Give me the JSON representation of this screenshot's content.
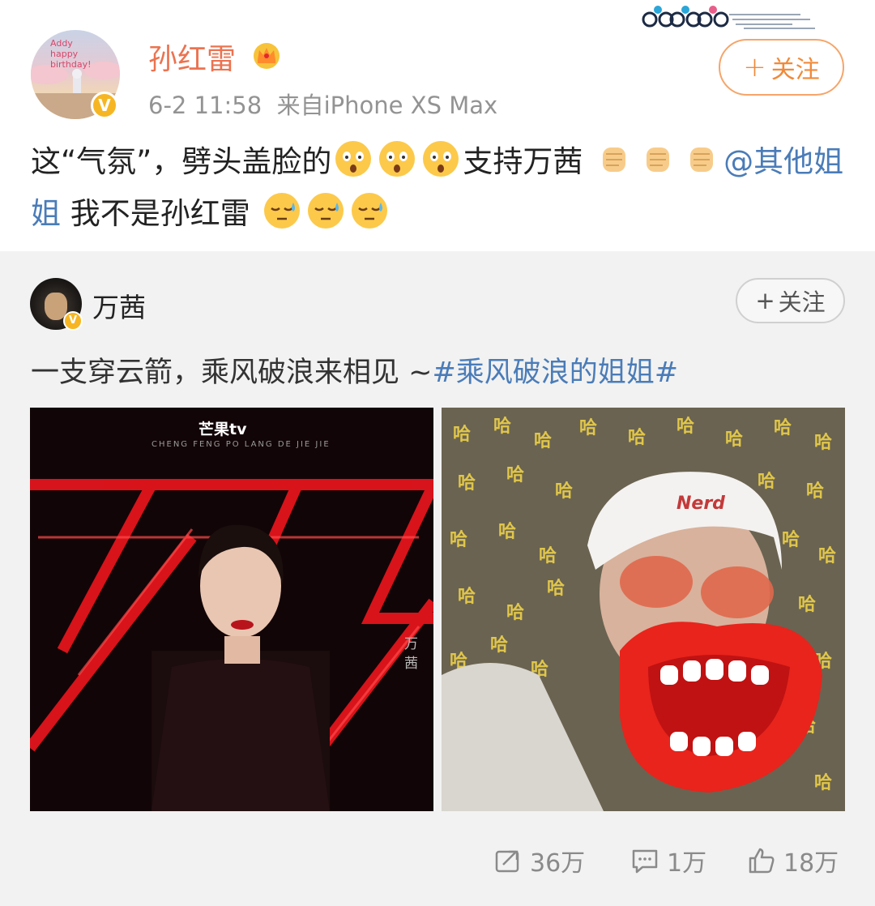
{
  "author": {
    "name": "孙红雷",
    "avatar_text_line1": "Addy",
    "avatar_text_line2": "happy birthday!",
    "verified_badge": "V",
    "time": "6-2 11:58",
    "source": "来自iPhone XS Max",
    "follow_label": "关注",
    "follow_plus": "+"
  },
  "post": {
    "text_part1": "这“气氛”，劈头盖脸的",
    "text_part2": "支持万茜",
    "mention": "@其他姐姐",
    "text_part3": " 我不是孙红雷",
    "emoji_group1": [
      "shocked-emoji",
      "shocked-emoji",
      "shocked-emoji"
    ],
    "emoji_group2": [
      "fist-emoji",
      "fist-emoji",
      "fist-emoji"
    ],
    "emoji_group3": [
      "sweat-emoji",
      "sweat-emoji",
      "sweat-emoji"
    ]
  },
  "repost": {
    "author_name": "万茜",
    "verified_badge": "V",
    "follow_label": "关注",
    "follow_plus": "+",
    "text": "一支穿云箭，乘风破浪来相见 ~",
    "hashtag": "#乘风破浪的姐姐#",
    "image1": {
      "logo": "芒果tv",
      "subtitle": "CHENG FENG PO LANG DE JIE JIE",
      "name_vertical": "万茜"
    },
    "image2": {
      "pattern_char": "哈",
      "cap_text": "Nerd"
    }
  },
  "actions": {
    "repost_count": "36万",
    "comment_count": "1万",
    "like_count": "18万"
  },
  "colors": {
    "username": "#eb7350",
    "link": "#4a7cb8",
    "follow": "#f08a3a",
    "repost_bg": "#f2f2f2"
  }
}
